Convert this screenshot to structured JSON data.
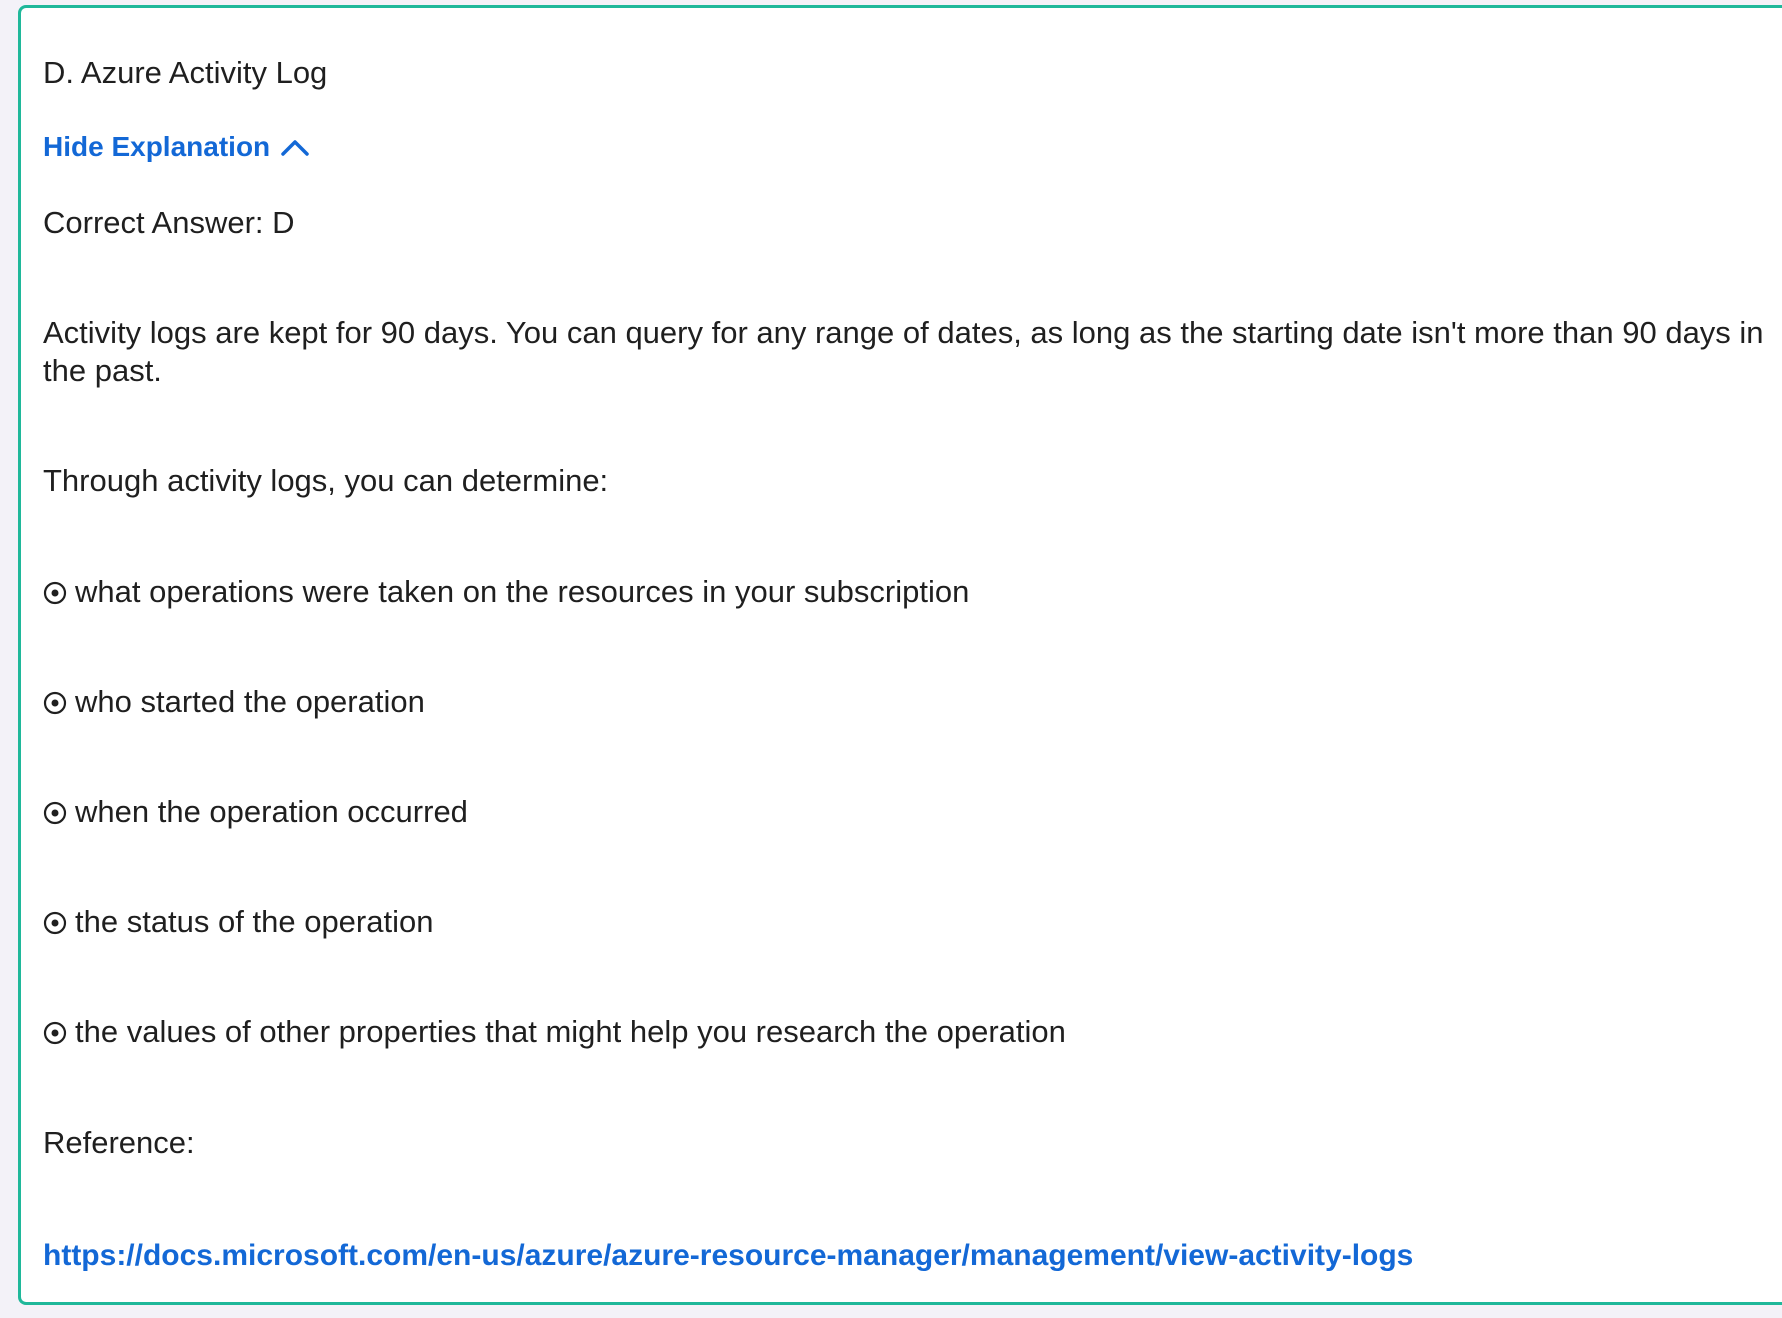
{
  "answer_option": "D. Azure Activity Log",
  "toggle_label": "Hide Explanation",
  "correct_answer": "Correct Answer: D",
  "paragraph": "Activity logs are kept for 90 days. You can query for any range of dates, as long as the starting date isn't more than 90 days in the past.",
  "intro": "Through activity logs, you can determine:",
  "bullets": [
    "what operations were taken on the resources in your subscription",
    "who started the operation",
    "when the operation occurred",
    "the status of the operation",
    "the values of other properties that might help you research the operation"
  ],
  "reference_label": "Reference:",
  "reference_url": "https://docs.microsoft.com/en-us/azure/azure-resource-manager/management/view-activity-logs",
  "colors": {
    "border": "#1fb89a",
    "link": "#1368d6",
    "text": "#1f1f1f",
    "background": "#f3f2f8"
  },
  "icons": {
    "toggle": "chevron-up-icon",
    "bullet": "circle-dot-icon"
  }
}
